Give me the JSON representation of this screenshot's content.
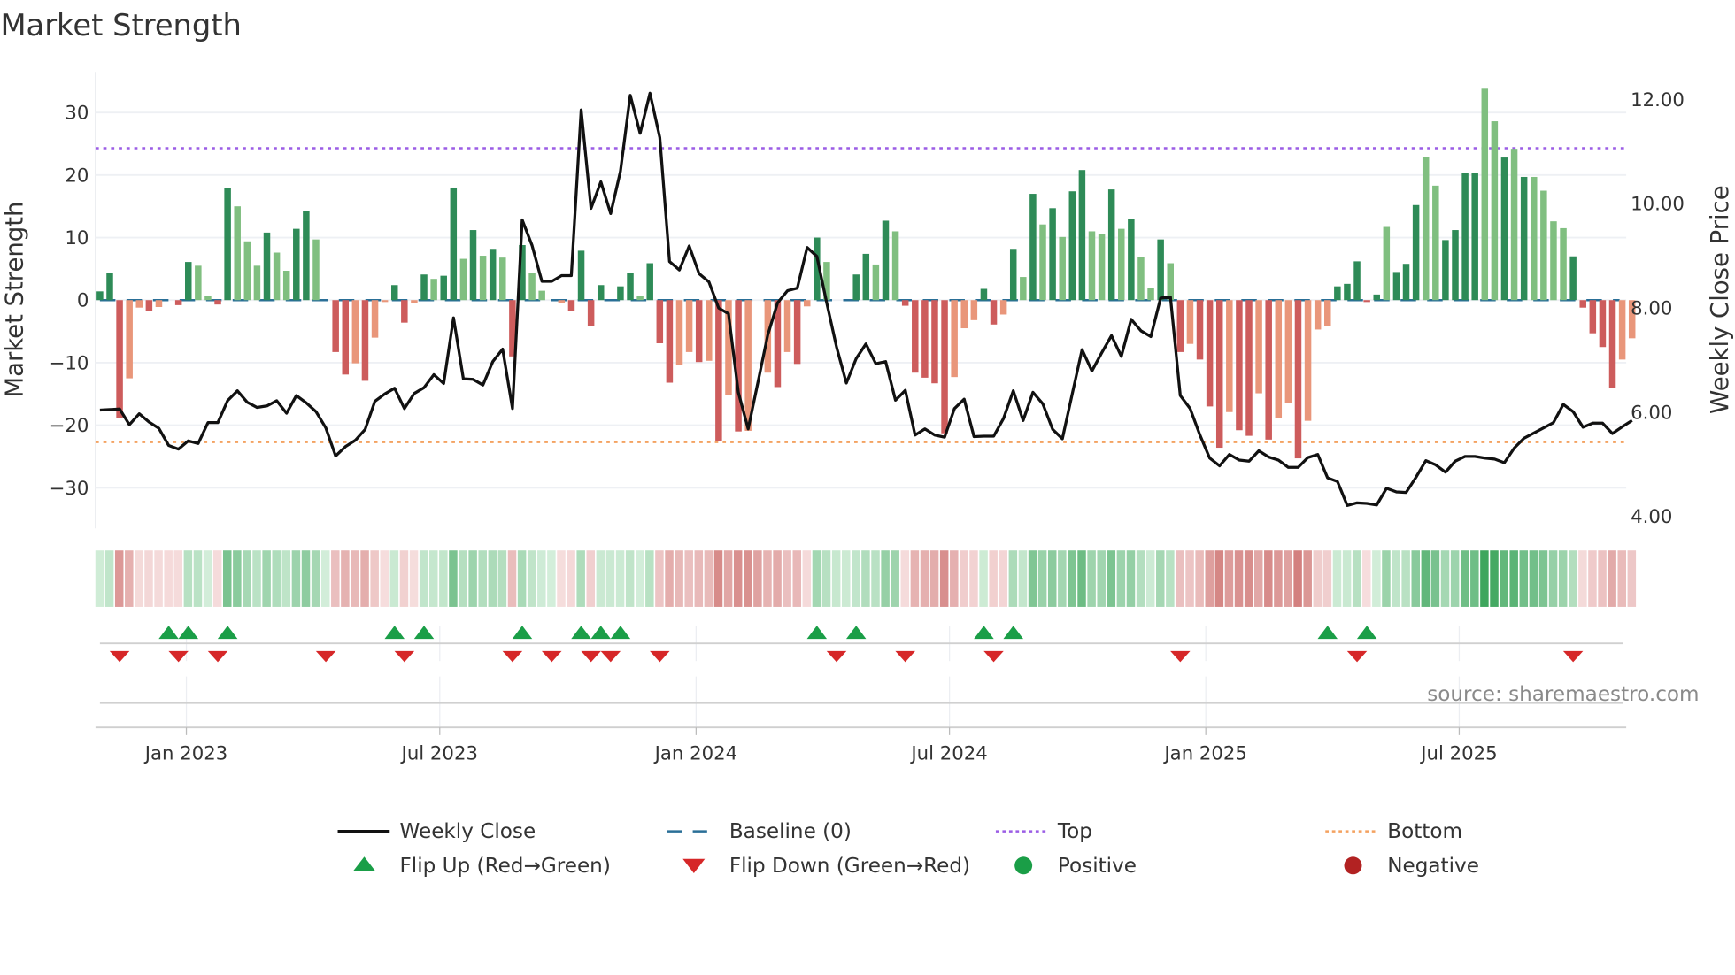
{
  "title": "Market Strength",
  "source": "source: sharemaestro.com",
  "colors": {
    "pos_dark": "#2e8b57",
    "pos_light": "#80bf80",
    "neg_dark": "#cd5c5c",
    "neg_light": "#e9967a",
    "baseline": "#2a6f97",
    "top": "#9b5de5",
    "bottom": "#f4a261",
    "flip_up": "#1a9e47",
    "flip_down": "#d62728",
    "positive": "#1a9e47",
    "negative": "#b22222",
    "close": "#111111"
  },
  "legend": [
    {
      "label": "Weekly Close",
      "symbol": "solid-line"
    },
    {
      "label": "Baseline (0)",
      "symbol": "dashed-line"
    },
    {
      "label": "Top",
      "symbol": "dotted-line-purple"
    },
    {
      "label": "Bottom",
      "symbol": "dotted-line-orange"
    },
    {
      "label": "Flip Up (Red→Green)",
      "symbol": "triangle-up"
    },
    {
      "label": "Flip Down (Green→Red)",
      "symbol": "triangle-down"
    },
    {
      "label": "Positive",
      "symbol": "circle-green"
    },
    {
      "label": "Negative",
      "symbol": "circle-red"
    }
  ],
  "chart_data": {
    "type": "bar",
    "title": "Market Strength",
    "ylabel": "Market Strength",
    "y2label": "Weekly Close Price",
    "ylim": [
      -36.5,
      36.5
    ],
    "y2lim": [
      3.77,
      12.53
    ],
    "yticks": [
      30,
      20,
      10,
      0,
      -10,
      -20,
      -30
    ],
    "ytick_labels": [
      "30",
      "20",
      "10",
      "0",
      "−10",
      "−20",
      "−30"
    ],
    "y2ticks": [
      12,
      10,
      8,
      6,
      4
    ],
    "y2tick_labels": [
      "12.00",
      "10.00",
      "8.00",
      "6.00",
      "4.00"
    ],
    "xticks": [
      8.8,
      34.6,
      60.7,
      86.5,
      112.6,
      138.4
    ],
    "xtick_labels": [
      "Jan 2023",
      "Jul 2023",
      "Jan 2024",
      "Jul 2024",
      "Jan 2025",
      "Jul 2025"
    ],
    "x_unit": "week index",
    "top_level": 24.3,
    "bottom_level": -22.7,
    "baseline": 0,
    "grid": true,
    "legend_position": "bottom",
    "strength": [
      1.4,
      4.3,
      -18.8,
      -12.5,
      -1.2,
      -1.8,
      -1.1,
      0,
      -0.8,
      6.1,
      5.5,
      0.7,
      -0.7,
      17.9,
      15,
      9.4,
      5.5,
      10.8,
      7.6,
      4.7,
      11.4,
      14.2,
      9.7,
      0,
      -8.3,
      -11.9,
      -10.1,
      -12.9,
      -6,
      -0.3,
      2.4,
      -3.6,
      -0.4,
      4.1,
      3.4,
      3.9,
      18,
      6.6,
      11.2,
      7.1,
      8.2,
      6.8,
      -9,
      8.8,
      4.4,
      1.5,
      0,
      -0.4,
      -1.7,
      7.9,
      -4.1,
      2.4,
      0,
      2.2,
      4.4,
      0.7,
      5.9,
      -6.9,
      -13.2,
      -10.4,
      -8.3,
      -9.9,
      -9.7,
      -22.5,
      -15.2,
      -21,
      -20.9,
      0,
      -11.6,
      -13.9,
      -8.3,
      -10.2,
      -1,
      10,
      6.1,
      0,
      0,
      4.1,
      7.4,
      5.7,
      12.7,
      11,
      -0.9,
      -11.6,
      -12.4,
      -13.3,
      -21.3,
      -12.3,
      -4.5,
      -3.2,
      1.8,
      -3.9,
      -2.3,
      8.2,
      3.7,
      17,
      12.1,
      14.7,
      10.1,
      17.4,
      20.8,
      11,
      10.5,
      17.7,
      11.4,
      13,
      6.9,
      2,
      9.7,
      5.9,
      -8.3,
      -7,
      -9.5,
      -17,
      -23.6,
      -17.9,
      -20.8,
      -21.7,
      -14.9,
      -22.3,
      -18.8,
      -16.5,
      -25.3,
      -19.3,
      -4.7,
      -4.2,
      2.2,
      2.6,
      6.2,
      -0.3,
      0.9,
      11.7,
      4.5,
      5.8,
      15.2,
      22.9,
      18.3,
      9.6,
      11.2,
      20.3,
      20.3,
      33.8,
      28.6,
      22.8,
      24.2,
      19.7,
      19.7,
      17.5,
      12.6,
      11.5,
      7,
      -1.2,
      -5.3,
      -7.5,
      -14,
      -9.5,
      -6.1
    ],
    "shade": "dddlldl0ddllddllldllddl0ddldllddldlddldldlddll0ldddd0ddldddlldldldl0ldldldl00ddldldddddlllddldldldlddlldldlldldldddlddldlldllldddddldddllddddlldldlllldddddll",
    "close": [
      6.04,
      6.05,
      6.06,
      5.76,
      5.97,
      5.81,
      5.69,
      5.36,
      5.29,
      5.45,
      5.4,
      5.8,
      5.8,
      6.22,
      6.41,
      6.19,
      6.09,
      6.12,
      6.22,
      5.98,
      6.32,
      6.18,
      6.01,
      5.7,
      5.16,
      5.34,
      5.46,
      5.67,
      6.21,
      6.35,
      6.46,
      6.07,
      6.36,
      6.47,
      6.72,
      6.55,
      7.81,
      6.64,
      6.63,
      6.52,
      6.97,
      7.21,
      6.07,
      9.69,
      9.2,
      8.51,
      8.51,
      8.62,
      8.62,
      11.8,
      9.91,
      10.42,
      9.81,
      10.62,
      12.08,
      11.35,
      12.12,
      11.27,
      8.89,
      8.73,
      9.19,
      8.66,
      8.5,
      8.0,
      7.89,
      6.38,
      5.68,
      6.58,
      7.48,
      8.1,
      8.33,
      8.38,
      9.16,
      8.99,
      8.1,
      7.25,
      6.56,
      7.03,
      7.31,
      6.93,
      6.97,
      6.23,
      6.42,
      5.56,
      5.68,
      5.56,
      5.52,
      6.07,
      6.25,
      5.53,
      5.54,
      5.54,
      5.88,
      6.41,
      5.84,
      6.38,
      6.16,
      5.67,
      5.49,
      6.35,
      7.2,
      6.79,
      7.14,
      7.47,
      7.07,
      7.78,
      7.56,
      7.45,
      8.19,
      8.21,
      6.32,
      6.07,
      5.56,
      5.12,
      4.97,
      5.19,
      5.08,
      5.06,
      5.26,
      5.14,
      5.08,
      4.94,
      4.94,
      5.13,
      5.19,
      4.74,
      4.67,
      4.21,
      4.26,
      4.25,
      4.22,
      4.54,
      4.47,
      4.46,
      4.75,
      5.07,
      4.99,
      4.85,
      5.06,
      5.15,
      5.15,
      5.12,
      5.1,
      5.03,
      5.31,
      5.5,
      5.6,
      5.7,
      5.8,
      6.15,
      6.01,
      5.71,
      5.79,
      5.79,
      5.59,
      5.72,
      5.84
    ],
    "flip_up": [
      7,
      9,
      13,
      30,
      33,
      43,
      49,
      51,
      53,
      73,
      77,
      90,
      93,
      125,
      129
    ],
    "flip_down": [
      2,
      8,
      12,
      23,
      31,
      42,
      46,
      50,
      52,
      57,
      75,
      82,
      91,
      110,
      128,
      150
    ]
  }
}
